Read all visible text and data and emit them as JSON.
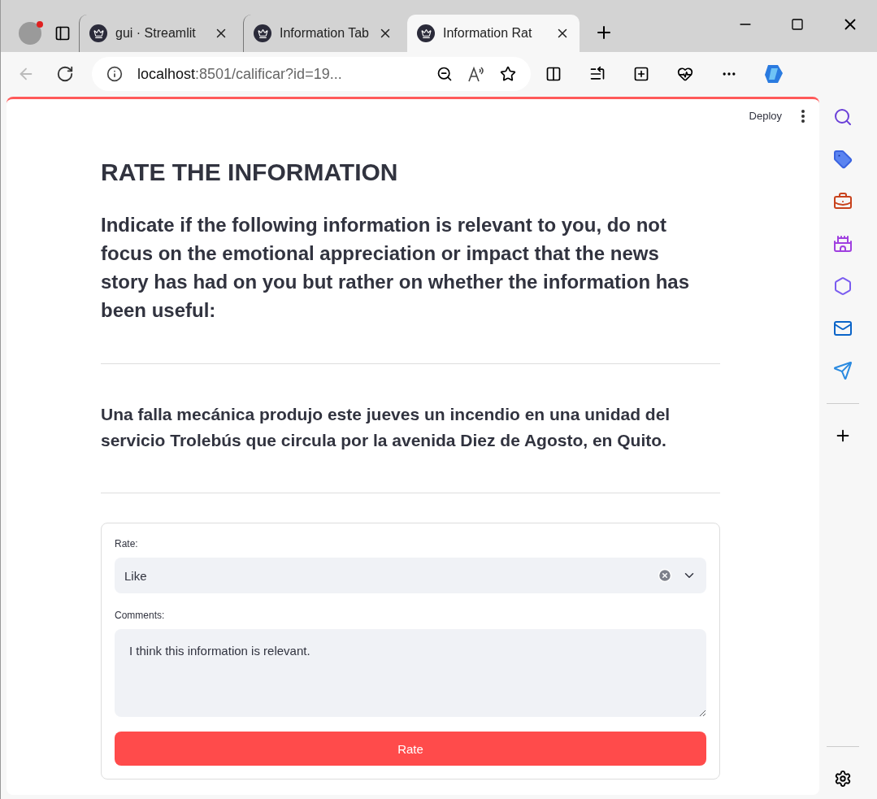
{
  "browser": {
    "tabs": [
      {
        "label": "gui · Streamlit",
        "selected": false
      },
      {
        "label": "Information Tab",
        "selected": false
      },
      {
        "label": "Information Rat",
        "selected": true
      }
    ],
    "back_disabled": true,
    "address": {
      "host": "localhost",
      "path": ":8501/calificar?id=19..."
    }
  },
  "app_header": {
    "deploy": "Deploy"
  },
  "title": "RATE THE INFORMATION",
  "instructions": "Indicate if the following information is relevant to you, do not focus on the emotional appreciation or impact that the news story has had on you but rather on whether the information has been useful:",
  "news": "Una falla mecánica produjo este jueves un incendio en una unidad del servicio Trolebús que circula por la avenida Diez de Agosto, en Quito.",
  "form": {
    "rate_label": "Rate:",
    "rate_value": "Like",
    "comments_label": "Comments:",
    "comments_value": "I think this information is relevant.",
    "submit": "Rate"
  }
}
